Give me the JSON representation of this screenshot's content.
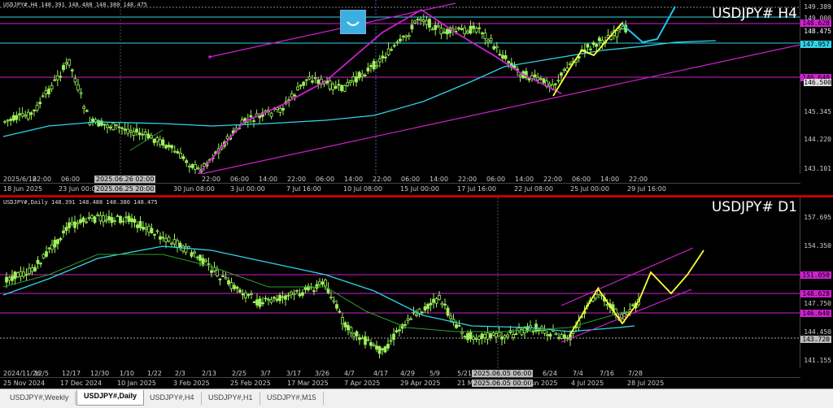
{
  "h4": {
    "title": "USDJPY# H4",
    "info": "USDJPY#,H4  148.391 148.488 148.380 148.475",
    "prices": [
      "149.389",
      "149.000",
      "148.475",
      "147.957",
      "146.500",
      "145.345",
      "144.220",
      "143.101"
    ],
    "tag_prices": {
      "p1": "148.628",
      "p2": "147.957",
      "p3": "146.640"
    },
    "time_labels": [
      "2025/6/18",
      "22:00",
      "06:00",
      "2025.06.26 02:00",
      "14:00",
      "22:00",
      "06:00",
      "14:00",
      "22:00",
      "06:00",
      "14:00",
      "22:00",
      "06:00",
      "14:00",
      "22:00",
      "06:00",
      "14:00",
      "22:00",
      "06:00",
      "14:00",
      "22:00"
    ],
    "date_labels": [
      "18 Jun 2025",
      "23 Jun 00:00",
      "2025.06.25 20:00",
      "30 Jun 08:00",
      "3 Jul 00:00",
      "7 Jul 16:00",
      "10 Jul 08:00",
      "15 Jul 00:00",
      "17 Jul 16:00",
      "22 Jul 08:00",
      "25 Jul 00:00",
      "29 Jul 16:00"
    ]
  },
  "d1": {
    "title": "USDJPY# D1",
    "info": "USDJPY#,Daily  148.391 148.488 148.380 148.475",
    "prices": [
      "157.695",
      "154.350",
      "147.750",
      "144.450",
      "141.155"
    ],
    "tag_prices": {
      "p1": "151.050",
      "p2": "148.628",
      "p3": "146.640",
      "p4": "143.720"
    },
    "time_labels": [
      "2024/11/26",
      "12/5",
      "12/17",
      "12/30",
      "1/10",
      "1/22",
      "2/3",
      "2/13",
      "2/25",
      "3/7",
      "3/17",
      "3/26",
      "4/7",
      "4/17",
      "4/29",
      "5/9",
      "5/21",
      "2025.06.05 06:00",
      "6/24",
      "7/4",
      "7/16",
      "7/28"
    ],
    "date_labels": [
      "25 Nov 2024",
      "17 Dec 2024",
      "10 Jan 2025",
      "3 Feb 2025",
      "25 Feb 2025",
      "17 Mar 2025",
      "7 Apr 2025",
      "29 Apr 2025",
      "21 M",
      "2025.06.05 00:00",
      "Jun 2025",
      "4 Jul 2025",
      "28 Jul 2025"
    ]
  },
  "tabs": [
    "USDJPY#,Weekly",
    "USDJPY#,Daily",
    "USDJPY#,H4",
    "USDJPY#,H1",
    "USDJPY#,M15"
  ],
  "active_tab": "USDJPY#,Daily",
  "colors": {
    "ma_long": "#30d5e8",
    "trend": "#d020d0",
    "highlight": "#ffff33",
    "ma_short": "#2e9e2e",
    "candle": "#9df05a"
  }
}
